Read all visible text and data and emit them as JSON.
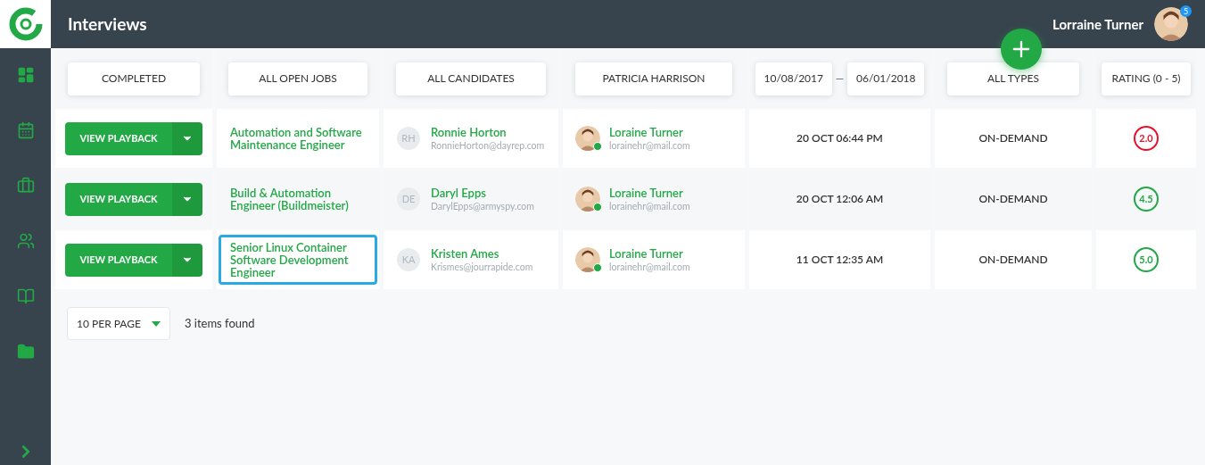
{
  "header": {
    "title": "Interviews",
    "user_name": "Lorraine Turner",
    "notification_count": "5"
  },
  "sidebar": {
    "items": [
      {
        "selected": false
      },
      {
        "selected": false
      },
      {
        "selected": false
      },
      {
        "selected": false
      },
      {
        "selected": false
      },
      {
        "selected": false
      }
    ]
  },
  "filters": [
    {
      "kind": "select",
      "label": "COMPLETED"
    },
    {
      "kind": "select",
      "label": "ALL OPEN JOBS"
    },
    {
      "kind": "select",
      "label": "ALL CANDIDATES"
    },
    {
      "kind": "select",
      "label": "PATRICIA HARRISON"
    },
    {
      "kind": "daterange",
      "from": "10/08/2017",
      "separator": "—",
      "to": "06/01/2018"
    },
    {
      "kind": "select",
      "label": "ALL TYPES"
    },
    {
      "kind": "select",
      "label": "RATING (0 - 5)"
    }
  ],
  "rows": [
    {
      "action": "VIEW PLAYBACK",
      "job": "Automation and Software Maintenance Engineer",
      "job_selected": false,
      "candidate_initials": "RH",
      "candidate_name": "Ronnie Horton",
      "candidate_email": "RonnieHorton@dayrep.com",
      "interviewer_name": "Loraine Turner",
      "interviewer_email": "lorainehr@mail.com",
      "interviewer_online": true,
      "date": "20 OCT 06:44 PM",
      "type": "ON-DEMAND",
      "rating": {
        "text": "2.0",
        "color": "#e8112d"
      }
    },
    {
      "action": "VIEW PLAYBACK",
      "job": "Build & Automation Engineer (Buildmeister)",
      "job_selected": false,
      "candidate_initials": "DE",
      "candidate_name": "Daryl Epps",
      "candidate_email": "DarylEpps@armyspy.com",
      "interviewer_name": "Loraine Turner",
      "interviewer_email": "lorainehr@mail.com",
      "interviewer_online": true,
      "date": "20 OCT 12:06 AM",
      "type": "ON-DEMAND",
      "rating": {
        "text": "4.5",
        "color": "#22a845"
      }
    },
    {
      "action": "VIEW PLAYBACK",
      "job": "Senior Linux Container Software Development Engineer",
      "job_selected": true,
      "candidate_initials": "KA",
      "candidate_name": "Kristen Ames",
      "candidate_email": "Krismes@jourrapide.com",
      "interviewer_name": "Loraine Turner",
      "interviewer_email": "lorainehr@mail.com",
      "interviewer_online": true,
      "date": "11 OCT 12:35 AM",
      "type": "ON-DEMAND",
      "rating": {
        "text": "5.0",
        "color": "#22a845"
      }
    }
  ],
  "pagination": {
    "per_page": "10 PER PAGE",
    "count": "3 items found"
  }
}
